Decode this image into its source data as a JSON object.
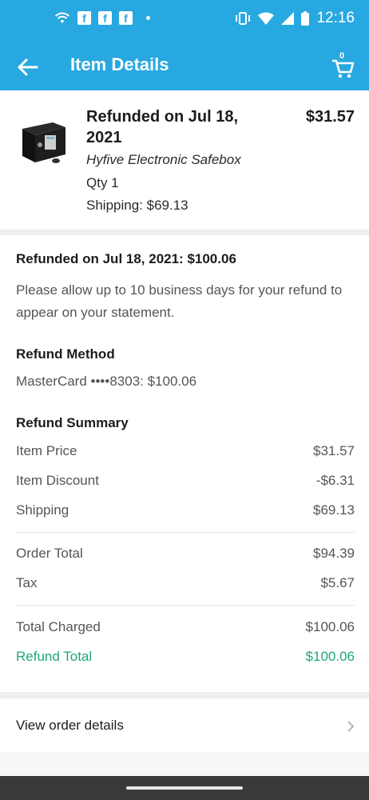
{
  "status_bar": {
    "time": "12:16",
    "notification_icons": [
      "wifi-icon",
      "facebook-icon",
      "facebook-icon",
      "facebook-icon",
      "dot-icon"
    ],
    "system_icons": [
      "vibrate-icon",
      "wifi-signal-icon",
      "cell-signal-icon",
      "battery-icon"
    ]
  },
  "app_bar": {
    "title": "Item Details",
    "cart_count": "0"
  },
  "item": {
    "status": "Refunded on Jul 18, 2021",
    "price": "$31.57",
    "name": "Hyfive Electronic Safebox",
    "qty": "Qty 1",
    "shipping": "Shipping: $69.13"
  },
  "refund": {
    "headline": "Refunded on Jul 18, 2021: $100.06",
    "note": "Please allow up to 10 business days for your refund to appear on your statement.",
    "method_heading": "Refund Method",
    "method_value": "MasterCard ••••8303: $100.06",
    "summary_heading": "Refund Summary"
  },
  "summary": {
    "item_price": {
      "label": "Item Price",
      "value": "$31.57"
    },
    "item_discount": {
      "label": "Item Discount",
      "value": "-$6.31"
    },
    "shipping": {
      "label": "Shipping",
      "value": "$69.13"
    },
    "order_total": {
      "label": "Order Total",
      "value": "$94.39"
    },
    "tax": {
      "label": "Tax",
      "value": "$5.67"
    },
    "total_charged": {
      "label": "Total Charged",
      "value": "$100.06"
    },
    "refund_total": {
      "label": "Refund Total",
      "value": "$100.06"
    }
  },
  "links": {
    "view_order": "View order details"
  },
  "colors": {
    "brand": "#28a8e0",
    "refund_green": "#1fa874"
  }
}
